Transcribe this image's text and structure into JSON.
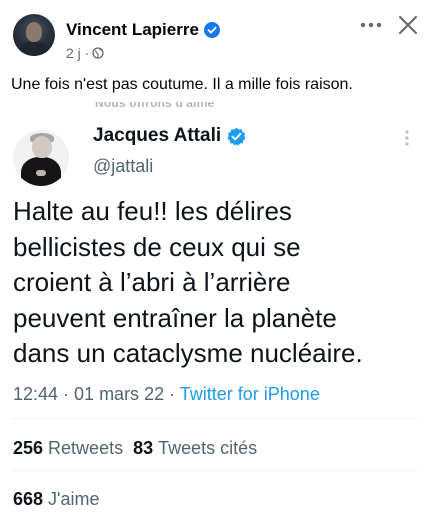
{
  "post": {
    "author": "Vincent Lapierre",
    "age": "2 j ·",
    "caption": "Une fois n'est pas coutume. Il a mille fois raison."
  },
  "tweet": {
    "partial_header": "Nous offrons d'aime",
    "author": "Jacques Attali",
    "handle": "@jattali",
    "text_lines": [
      "Halte au feu!! les délires",
      "bellicistes de ceux qui se",
      "croient à l’abri à l’arrière",
      "peuvent entraîner la planète",
      "dans un cataclysme nucléaire."
    ],
    "timestamp": "12:44 · 01 mars 22 · ",
    "source": "Twitter for iPhone",
    "retweets_count": "256",
    "retweets_label": "Retweets",
    "quotes_count": "83",
    "quotes_label": "Tweets cités",
    "likes_count": "668",
    "likes_label": "J'aime"
  },
  "colors": {
    "facebook_verified": "#1877f2",
    "twitter_verified": "#1d9bf0",
    "twitter_link": "#1d9bf0",
    "secondary_text": "#65676b"
  },
  "icons": {
    "post_verified": "verified-badge-icon",
    "post_audience": "globe-icon",
    "post_more": "more-horizontal-icon",
    "post_close": "close-icon",
    "tweet_verified": "verified-badge-icon",
    "tweet_more": "more-vertical-icon"
  }
}
